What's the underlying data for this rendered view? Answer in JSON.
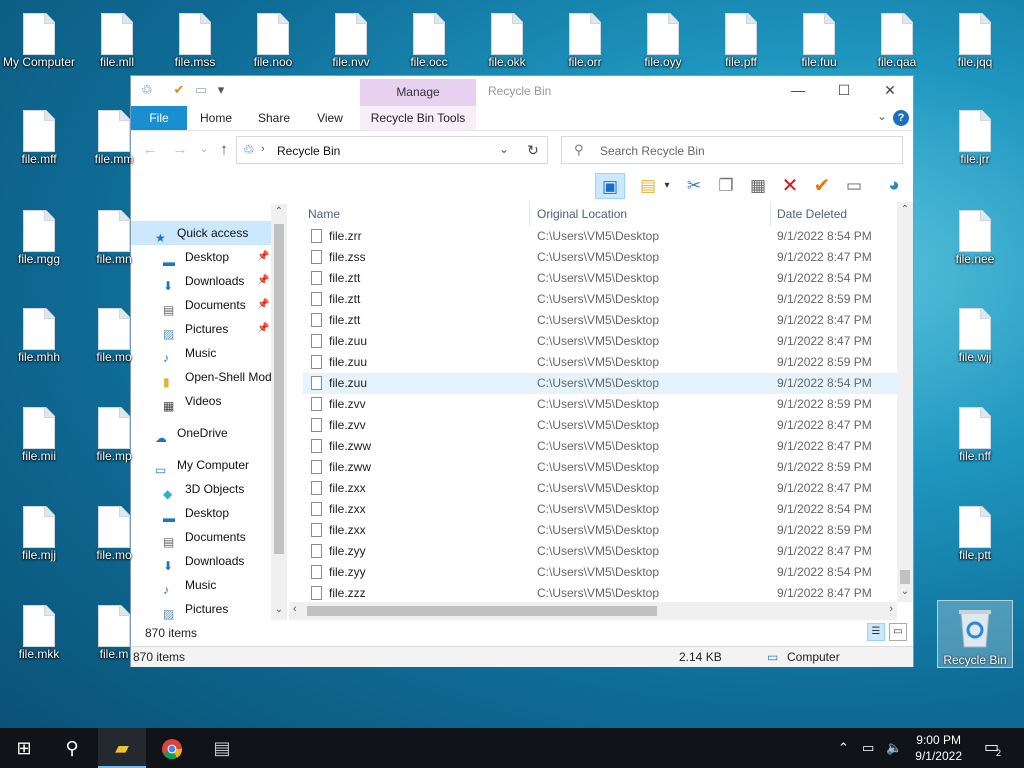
{
  "desktop": {
    "icons_top": [
      "My Computer",
      "file.mll",
      "file.mss",
      "file.noo",
      "file.nvv",
      "file.occ",
      "file.okk",
      "file.orr",
      "file.oyy",
      "file.pff",
      "file.fuu",
      "file.qaa",
      "file.jqq"
    ],
    "icons_col1": [
      "file.mff",
      "file.mgg",
      "file.mhh",
      "file.mii",
      "file.mjj",
      "file.mkk"
    ],
    "icons_col2": [
      "file.mm",
      "file.mn",
      "file.mo",
      "file.mp",
      "file.mo",
      "file.m"
    ],
    "icons_right": [
      "file.jrr",
      "file.nee",
      "file.wjj",
      "file.nff",
      "file.ptt"
    ],
    "recycle_bin": "Recycle Bin"
  },
  "window": {
    "title": "Recycle Bin",
    "manage_tab": "Manage",
    "ribbon_tabs": [
      "File",
      "Home",
      "Share",
      "View",
      "Recycle Bin Tools"
    ],
    "help": "?",
    "address": "Recycle Bin",
    "search_placeholder": "Search Recycle Bin",
    "nav": {
      "quick_access": "Quick access",
      "qa_items": [
        "Desktop",
        "Downloads",
        "Documents",
        "Pictures",
        "Music",
        "Open-Shell Mod",
        "Videos"
      ],
      "onedrive": "OneDrive",
      "my_computer": "My Computer",
      "mc_items": [
        "3D Objects",
        "Desktop",
        "Documents",
        "Downloads",
        "Music",
        "Pictures"
      ]
    },
    "columns": [
      "Name",
      "Original Location",
      "Date Deleted"
    ],
    "files": [
      {
        "name": "file.zrr",
        "location": "C:\\Users\\VM5\\Desktop",
        "date": "9/1/2022 8:54 PM"
      },
      {
        "name": "file.zss",
        "location": "C:\\Users\\VM5\\Desktop",
        "date": "9/1/2022 8:47 PM"
      },
      {
        "name": "file.ztt",
        "location": "C:\\Users\\VM5\\Desktop",
        "date": "9/1/2022 8:54 PM"
      },
      {
        "name": "file.ztt",
        "location": "C:\\Users\\VM5\\Desktop",
        "date": "9/1/2022 8:59 PM"
      },
      {
        "name": "file.ztt",
        "location": "C:\\Users\\VM5\\Desktop",
        "date": "9/1/2022 8:47 PM"
      },
      {
        "name": "file.zuu",
        "location": "C:\\Users\\VM5\\Desktop",
        "date": "9/1/2022 8:47 PM"
      },
      {
        "name": "file.zuu",
        "location": "C:\\Users\\VM5\\Desktop",
        "date": "9/1/2022 8:59 PM"
      },
      {
        "name": "file.zuu",
        "location": "C:\\Users\\VM5\\Desktop",
        "date": "9/1/2022 8:54 PM"
      },
      {
        "name": "file.zvv",
        "location": "C:\\Users\\VM5\\Desktop",
        "date": "9/1/2022 8:59 PM"
      },
      {
        "name": "file.zvv",
        "location": "C:\\Users\\VM5\\Desktop",
        "date": "9/1/2022 8:47 PM"
      },
      {
        "name": "file.zww",
        "location": "C:\\Users\\VM5\\Desktop",
        "date": "9/1/2022 8:47 PM"
      },
      {
        "name": "file.zww",
        "location": "C:\\Users\\VM5\\Desktop",
        "date": "9/1/2022 8:59 PM"
      },
      {
        "name": "file.zxx",
        "location": "C:\\Users\\VM5\\Desktop",
        "date": "9/1/2022 8:47 PM"
      },
      {
        "name": "file.zxx",
        "location": "C:\\Users\\VM5\\Desktop",
        "date": "9/1/2022 8:54 PM"
      },
      {
        "name": "file.zxx",
        "location": "C:\\Users\\VM5\\Desktop",
        "date": "9/1/2022 8:59 PM"
      },
      {
        "name": "file.zyy",
        "location": "C:\\Users\\VM5\\Desktop",
        "date": "9/1/2022 8:47 PM"
      },
      {
        "name": "file.zyy",
        "location": "C:\\Users\\VM5\\Desktop",
        "date": "9/1/2022 8:54 PM"
      },
      {
        "name": "file.zzz",
        "location": "C:\\Users\\VM5\\Desktop",
        "date": "9/1/2022 8:47 PM"
      }
    ],
    "selected_row": 7,
    "items_count": "870 items",
    "status": {
      "items": "870 items",
      "size": "2.14 KB",
      "location": "Computer"
    }
  },
  "taskbar": {
    "time": "9:00 PM",
    "date": "9/1/2022",
    "notifications": "2"
  },
  "colors": {
    "accent": "#1a8fd0",
    "selection": "#cce8ff",
    "manage": "#e8d1f0"
  }
}
